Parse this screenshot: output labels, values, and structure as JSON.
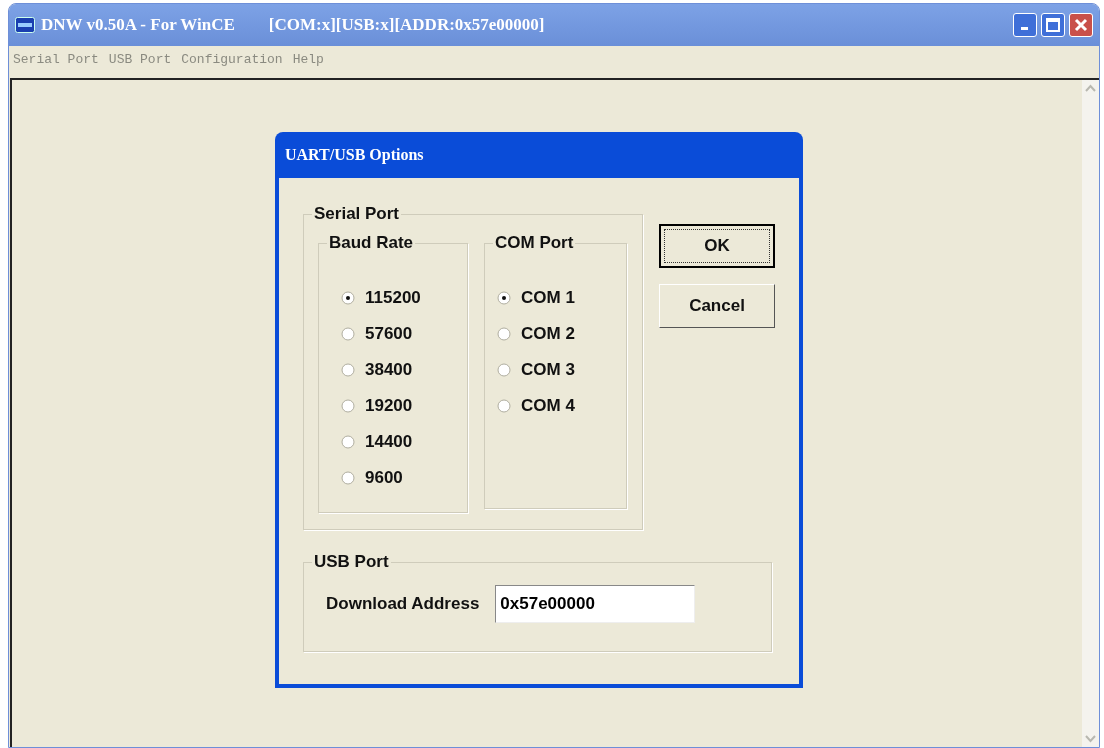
{
  "window": {
    "title": "DNW v0.50A - For WinCE",
    "status_text": "[COM:x][USB:x][ADDR:0x57e00000]"
  },
  "menu": [
    "Serial Port",
    "USB Port",
    "Configuration",
    "Help"
  ],
  "dialog": {
    "title": "UART/USB Options",
    "serial_port": {
      "label": "Serial Port",
      "baud_rate": {
        "label": "Baud Rate",
        "options": [
          {
            "label": "115200",
            "selected": true
          },
          {
            "label": "57600",
            "selected": false
          },
          {
            "label": "38400",
            "selected": false
          },
          {
            "label": "19200",
            "selected": false
          },
          {
            "label": "14400",
            "selected": false
          },
          {
            "label": "9600",
            "selected": false
          }
        ]
      },
      "com_port": {
        "label": "COM Port",
        "options": [
          {
            "label": "COM 1",
            "selected": true
          },
          {
            "label": "COM 2",
            "selected": false
          },
          {
            "label": "COM 3",
            "selected": false
          },
          {
            "label": "COM 4",
            "selected": false
          }
        ]
      }
    },
    "usb_port": {
      "label": "USB Port",
      "field_label": "Download Address",
      "value": "0x57e00000"
    },
    "buttons": [
      "OK",
      "Cancel"
    ]
  }
}
